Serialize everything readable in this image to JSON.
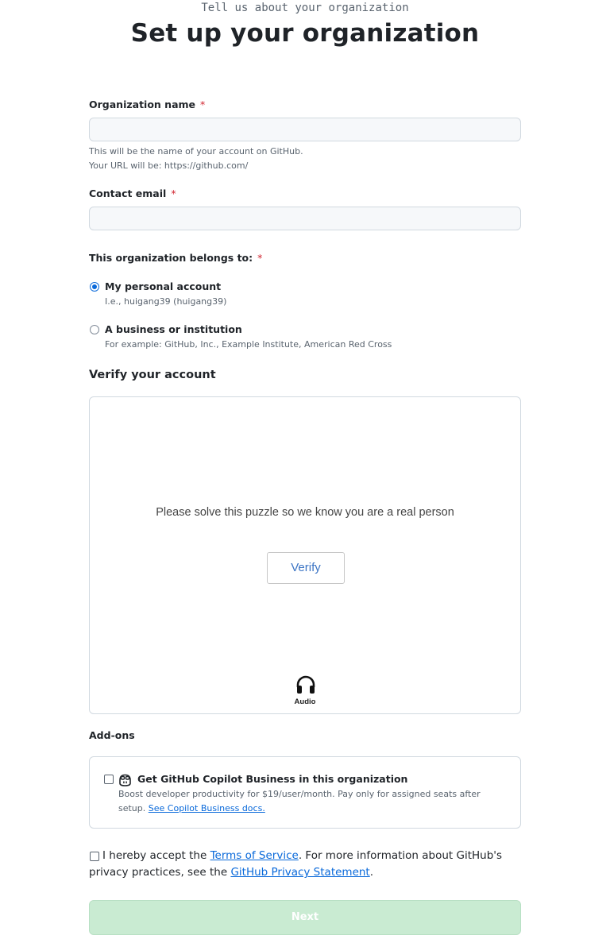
{
  "header": {
    "subtitle": "Tell us about your organization",
    "title": "Set up your organization"
  },
  "org_name": {
    "label": "Organization name",
    "required_marker": "*",
    "value": "",
    "help_line1": "This will be the name of your account on GitHub.",
    "help_line2": "Your URL will be: https://github.com/"
  },
  "contact_email": {
    "label": "Contact email",
    "required_marker": "*",
    "value": ""
  },
  "belongs_to": {
    "label": "This organization belongs to:",
    "required_marker": "*",
    "options": [
      {
        "label": "My personal account",
        "help": "I.e., huigang39 (huigang39)",
        "checked": true
      },
      {
        "label": "A business or institution",
        "help": "For example: GitHub, Inc., Example Institute, American Red Cross",
        "checked": false
      }
    ]
  },
  "verify": {
    "section_title": "Verify your account",
    "prompt": "Please solve this puzzle so we know you are a real person",
    "button_label": "Verify",
    "audio_label": "Audio",
    "audio_icon": "headphones-icon"
  },
  "addons": {
    "section_title": "Add-ons",
    "copilot": {
      "icon": "copilot-icon",
      "title": "Get GitHub Copilot Business in this organization",
      "desc": "Boost developer productivity for $19/user/month. Pay only for assigned seats after setup.",
      "link": "See Copilot Business docs.",
      "checked": false
    }
  },
  "terms": {
    "prefix": "I hereby accept the",
    "tos_link": "Terms of Service",
    "middle": ". For more information about GitHub's privacy practices, see the",
    "privacy_link": "GitHub Privacy Statement",
    "suffix": ".",
    "checked": false
  },
  "next_button": {
    "label": "Next",
    "color": "#c9ebd2"
  }
}
